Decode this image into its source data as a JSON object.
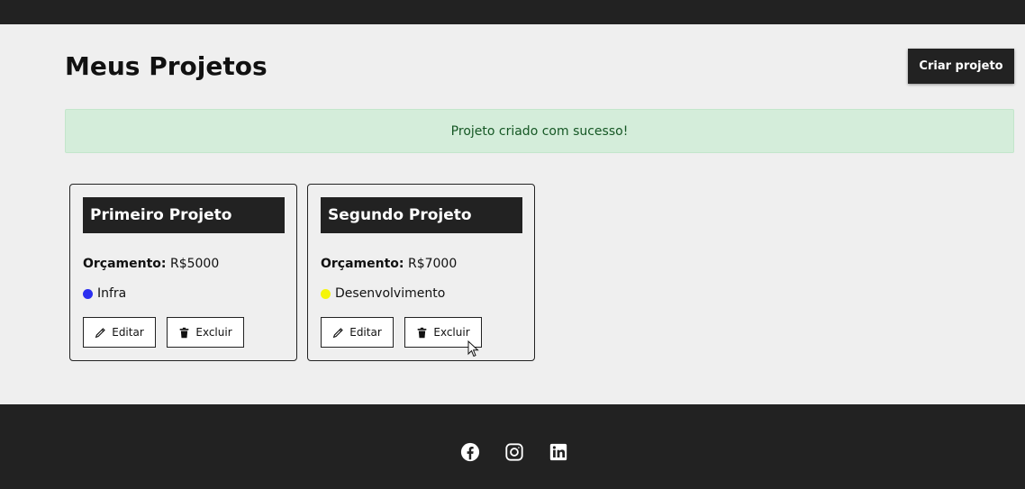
{
  "page": {
    "title": "Meus Projetos",
    "create_button": "Criar projeto"
  },
  "alert": {
    "message": "Projeto criado com sucesso!"
  },
  "projects": [
    {
      "name": "Primeiro Projeto",
      "budget_label": "Orçamento:",
      "budget_value": "R$5000",
      "category": "Infra",
      "category_color": "#2b2ff0",
      "edit_label": "Editar",
      "delete_label": "Excluir"
    },
    {
      "name": "Segundo Projeto",
      "budget_label": "Orçamento:",
      "budget_value": "R$7000",
      "category": "Desenvolvimento",
      "category_color": "#f5f50a",
      "edit_label": "Editar",
      "delete_label": "Excluir"
    }
  ],
  "icons": {
    "edit": "pencil-icon",
    "delete": "trash-icon",
    "social": [
      "facebook-icon",
      "instagram-icon",
      "linkedin-icon"
    ]
  },
  "colors": {
    "dark": "#222222",
    "background": "#efefef",
    "alert_bg": "#d4edda",
    "alert_text": "#155724"
  }
}
